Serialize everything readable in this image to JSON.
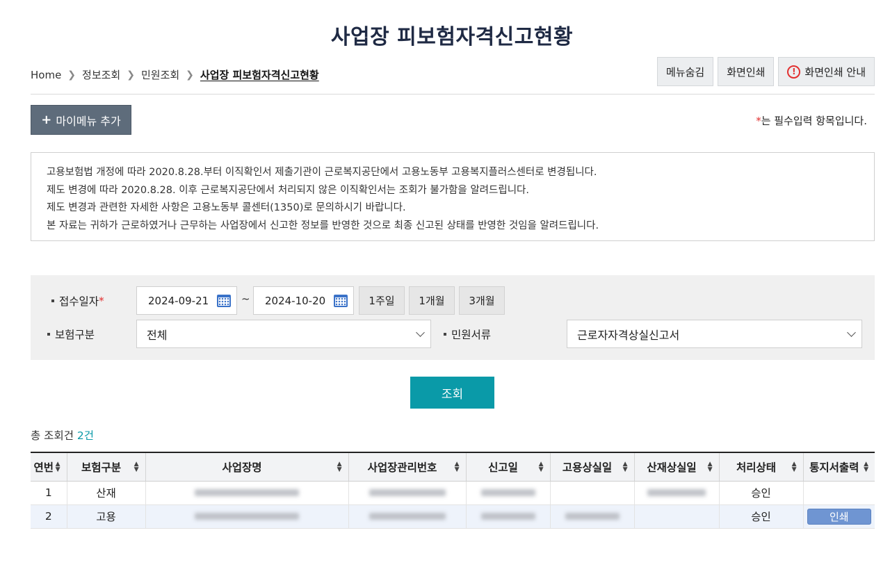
{
  "page": {
    "title": "사업장 피보험자격신고현황"
  },
  "breadcrumb": [
    "Home",
    "정보조회",
    "민원조회",
    "사업장 피보험자격신고현황"
  ],
  "top_buttons": {
    "hide_menu": "메뉴숨김",
    "print_screen": "화면인쇄",
    "print_guide": "화면인쇄 안내"
  },
  "mymenu": {
    "label": "마이메뉴 추가",
    "icon": "+"
  },
  "required_note": {
    "star": "*",
    "text": "는 필수입력 항목입니다."
  },
  "notice": [
    "고용보험법 개정에 따라 2020.8.28.부터 이직확인서 제출기관이 근로복지공단에서 고용노동부 고용복지플러스센터로 변경됩니다.",
    "제도 변경에 따라 2020.8.28. 이후 근로복지공단에서 처리되지 않은 이직확인서는 조회가 불가함을 알려드립니다.",
    "제도 변경과 관련한 자세한 사항은 고용노동부 콜센터(1350)로 문의하시기 바랍니다.",
    "본 자료는 귀하가 근로하였거나 근무하는 사업장에서 신고한 정보를 반영한 것으로 최종 신고된 상태를 반영한 것임을 알려드립니다."
  ],
  "search": {
    "date_label": "접수일자",
    "required_star": "*",
    "date_from": "2024-09-21",
    "tilde": "~",
    "date_to": "2024-10-20",
    "period_buttons": [
      "1주일",
      "1개월",
      "3개월"
    ],
    "insurance_label": "보험구분",
    "insurance_value": "전체",
    "doc_label": "민원서류",
    "doc_value": "근로자자격상실신고서",
    "submit": "조회"
  },
  "results": {
    "total_prefix": "총 조회건 ",
    "total_count": "2건",
    "columns": [
      "연번",
      "보험구분",
      "사업장명",
      "사업장관리번호",
      "신고일",
      "고용상실일",
      "산재상실일",
      "처리상태",
      "통지서출력"
    ],
    "rows": [
      {
        "no": "1",
        "type": "산재",
        "status": "승인",
        "print": ""
      },
      {
        "no": "2",
        "type": "고용",
        "status": "승인",
        "print": "인쇄"
      }
    ]
  },
  "colors": {
    "title": "#1f2a44",
    "accent": "#0a9aa8",
    "mymenu_bg": "#5e6c7b",
    "print_btn": "#6f95d2",
    "required": "#e23030",
    "calendar": "#3a72c8"
  },
  "icons": [
    "chevron-right-icon",
    "alert-icon",
    "plus-icon",
    "calendar-icon",
    "chevron-down-icon",
    "sort-icon"
  ]
}
